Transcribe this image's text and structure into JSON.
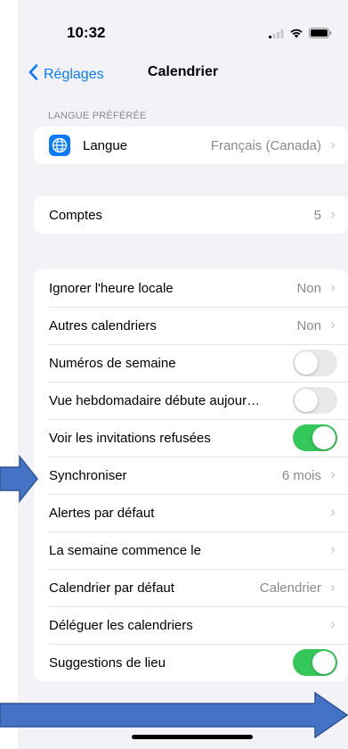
{
  "status_bar": {
    "time": "10:32"
  },
  "nav": {
    "back_label": "Réglages",
    "title": "Calendrier"
  },
  "language_section": {
    "header": "LANGUE PRÉFÉRÉE",
    "label": "Langue",
    "value": "Français (Canada)"
  },
  "accounts": {
    "label": "Comptes",
    "value": "5"
  },
  "settings": [
    {
      "label": "Ignorer l'heure locale",
      "value": "Non",
      "type": "disclosure"
    },
    {
      "label": "Autres calendriers",
      "value": "Non",
      "type": "disclosure"
    },
    {
      "label": "Numéros de semaine",
      "type": "toggle",
      "on": false
    },
    {
      "label": "Vue hebdomadaire débute aujour…",
      "type": "toggle",
      "on": false
    },
    {
      "label": "Voir les invitations refusées",
      "type": "toggle",
      "on": true
    },
    {
      "label": "Synchroniser",
      "value": "6 mois",
      "type": "disclosure"
    },
    {
      "label": "Alertes par défaut",
      "value": "",
      "type": "disclosure"
    },
    {
      "label": "La semaine commence le",
      "value": "",
      "type": "disclosure"
    },
    {
      "label": "Calendrier par défaut",
      "value": "Calendrier",
      "type": "disclosure"
    },
    {
      "label": "Déléguer les calendriers",
      "value": "",
      "type": "disclosure"
    },
    {
      "label": "Suggestions de lieu",
      "type": "toggle",
      "on": true
    }
  ],
  "colors": {
    "accent": "#0a7aff",
    "toggle_on": "#34c759",
    "toggle_off": "#e9e9eb",
    "annotation_arrow": "#4472c4"
  },
  "icons": {
    "back": "chevron-left-icon",
    "language": "globe-icon",
    "disclosure": "chevron-right-icon",
    "signal": "cellular-signal-icon",
    "wifi": "wifi-icon",
    "battery": "battery-icon"
  }
}
